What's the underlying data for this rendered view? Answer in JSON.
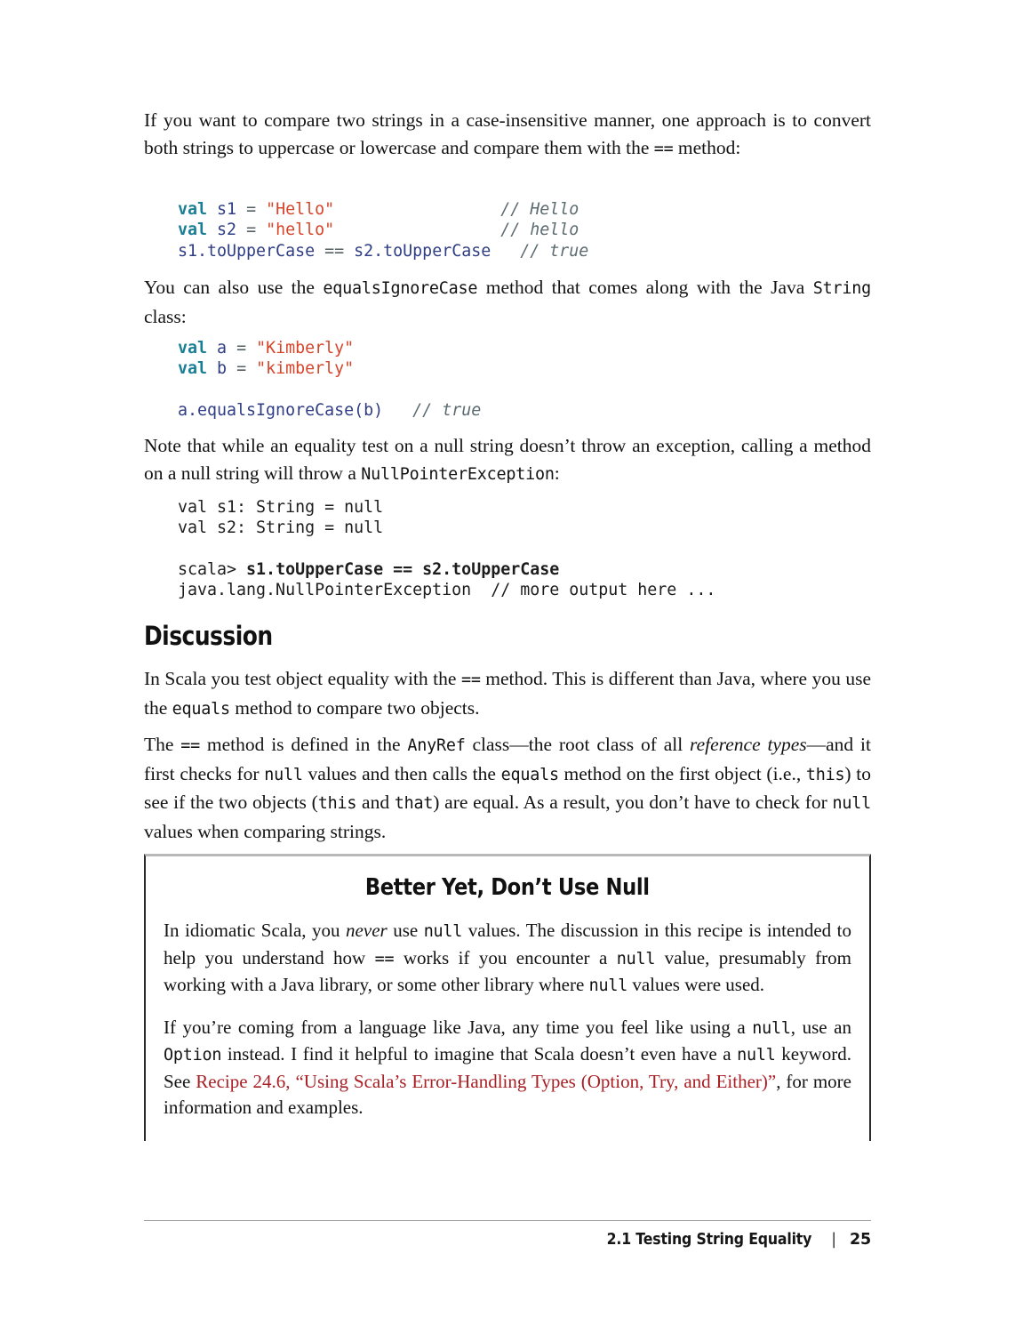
{
  "page": {
    "number": "25",
    "footer_title": "2.1 Testing String Equality",
    "footer_separator": "|"
  },
  "paragraphs": {
    "p1_a": "If you want to compare two strings in a case-insensitive manner, one approach is to convert both strings to uppercase or lowercase and compare them with the ",
    "p1_code": "==",
    "p1_b": " method:",
    "p2_a": "You can also use the ",
    "p2_code1": "equalsIgnoreCase",
    "p2_b": " method that comes along with the Java ",
    "p2_code2": "String",
    "p2_c": " class:",
    "p3_a": "Note that while an equality test on a null string doesn’t throw an exception, calling a method on a null string will throw a ",
    "p3_code": "NullPointerException",
    "p3_b": ":",
    "p4_a": "In Scala you test object equality with the ",
    "p4_code1": "==",
    "p4_b": " method. This is different than Java, where you use the ",
    "p4_code2": "equals",
    "p4_c": " method to compare two objects.",
    "p5_a": "The ",
    "p5_code1": "==",
    "p5_b": " method is defined in the ",
    "p5_code2": "AnyRef",
    "p5_c": " class—the root class of all ",
    "p5_em": "reference types",
    "p5_d": "—and it first checks for ",
    "p5_code3": "null",
    "p5_e": " values and then calls the ",
    "p5_code4": "equals",
    "p5_f": " method on the first object (i.e., ",
    "p5_code5": "this",
    "p5_g": ") to see if the two objects (",
    "p5_code6": "this",
    "p5_h": " and ",
    "p5_code7": "that",
    "p5_i": ") are equal. As a result, you don’t have to check for ",
    "p5_code8": "null",
    "p5_j": " values when comparing strings."
  },
  "heading": {
    "discussion": "Discussion"
  },
  "code_block_1": {
    "lines": [
      {
        "tokens": [
          {
            "t": "val",
            "c": "k-val"
          },
          {
            "t": " ",
            "c": ""
          },
          {
            "t": "s1",
            "c": "k-id"
          },
          {
            "t": " ",
            "c": ""
          },
          {
            "t": "=",
            "c": "k-op"
          },
          {
            "t": " ",
            "c": ""
          },
          {
            "t": "\"Hello\"",
            "c": "k-str"
          },
          {
            "t": "                 ",
            "c": ""
          },
          {
            "t": "// Hello",
            "c": "k-cmt"
          }
        ]
      },
      {
        "tokens": [
          {
            "t": "val",
            "c": "k-val"
          },
          {
            "t": " ",
            "c": ""
          },
          {
            "t": "s2",
            "c": "k-id"
          },
          {
            "t": " ",
            "c": ""
          },
          {
            "t": "=",
            "c": "k-op"
          },
          {
            "t": " ",
            "c": ""
          },
          {
            "t": "\"hello\"",
            "c": "k-str"
          },
          {
            "t": "                 ",
            "c": ""
          },
          {
            "t": "// hello",
            "c": "k-cmt"
          }
        ]
      },
      {
        "tokens": [
          {
            "t": "s1.toUpperCase",
            "c": "k-id"
          },
          {
            "t": " ",
            "c": ""
          },
          {
            "t": "==",
            "c": "k-op"
          },
          {
            "t": " ",
            "c": ""
          },
          {
            "t": "s2.toUpperCase",
            "c": "k-id"
          },
          {
            "t": "   ",
            "c": ""
          },
          {
            "t": "// true",
            "c": "k-cmt"
          }
        ]
      }
    ]
  },
  "code_block_2": {
    "lines": [
      {
        "tokens": [
          {
            "t": "val",
            "c": "k-val"
          },
          {
            "t": " ",
            "c": ""
          },
          {
            "t": "a",
            "c": "k-id"
          },
          {
            "t": " ",
            "c": ""
          },
          {
            "t": "=",
            "c": "k-op"
          },
          {
            "t": " ",
            "c": ""
          },
          {
            "t": "\"Kimberly\"",
            "c": "k-str"
          }
        ]
      },
      {
        "tokens": [
          {
            "t": "val",
            "c": "k-val"
          },
          {
            "t": " ",
            "c": ""
          },
          {
            "t": "b",
            "c": "k-id"
          },
          {
            "t": " ",
            "c": ""
          },
          {
            "t": "=",
            "c": "k-op"
          },
          {
            "t": " ",
            "c": ""
          },
          {
            "t": "\"kimberly\"",
            "c": "k-str"
          }
        ]
      },
      {
        "tokens": [
          {
            "t": " ",
            "c": ""
          }
        ]
      },
      {
        "tokens": [
          {
            "t": "a.equalsIgnoreCase(b)",
            "c": "k-id"
          },
          {
            "t": "   ",
            "c": ""
          },
          {
            "t": "// true",
            "c": "k-cmt"
          }
        ]
      }
    ]
  },
  "code_block_3": {
    "lines": [
      {
        "text": "val s1: String = null",
        "bold": false
      },
      {
        "text": "val s2: String = null",
        "bold": false
      },
      {
        "text": " ",
        "bold": false
      },
      {
        "prompt": "scala> ",
        "text": "s1.toUpperCase == s2.toUpperCase",
        "bold": true
      },
      {
        "text": "java.lang.NullPointerException  // more output here ...",
        "bold": false
      }
    ]
  },
  "sidebar": {
    "title": "Better Yet, Don’t Use Null",
    "p1_a": "In idiomatic Scala, you ",
    "p1_em": "never",
    "p1_b": " use ",
    "p1_code1": "null",
    "p1_c": " values. The discussion in this recipe is intended to help you understand how ",
    "p1_code2": "==",
    "p1_d": " works if you encounter a ",
    "p1_code3": "null",
    "p1_e": " value, presumably from working with a Java library, or some other library where ",
    "p1_code4": "null",
    "p1_f": " values were used.",
    "p2_a": "If you’re coming from a language like Java, any time you feel like using a ",
    "p2_code1": "null",
    "p2_b": ", use an ",
    "p2_code2": "Option",
    "p2_c": " instead. I find it helpful to imagine that Scala doesn’t even have a ",
    "p2_code3": "null",
    "p2_d": " keyword. See ",
    "p2_link": "Recipe 24.6, “Using Scala’s Error-Handling Types (Option, Try, and Either)”",
    "p2_e": ", for more information and examples."
  },
  "colors": {
    "keyword": "#1a7f94",
    "string": "#d6452a",
    "identifier": "#2f3d85",
    "comment": "#5c6b70",
    "cross_reference": "#a81f24",
    "rule": "#9a9a9a",
    "box_border": "#2b2b2b"
  }
}
